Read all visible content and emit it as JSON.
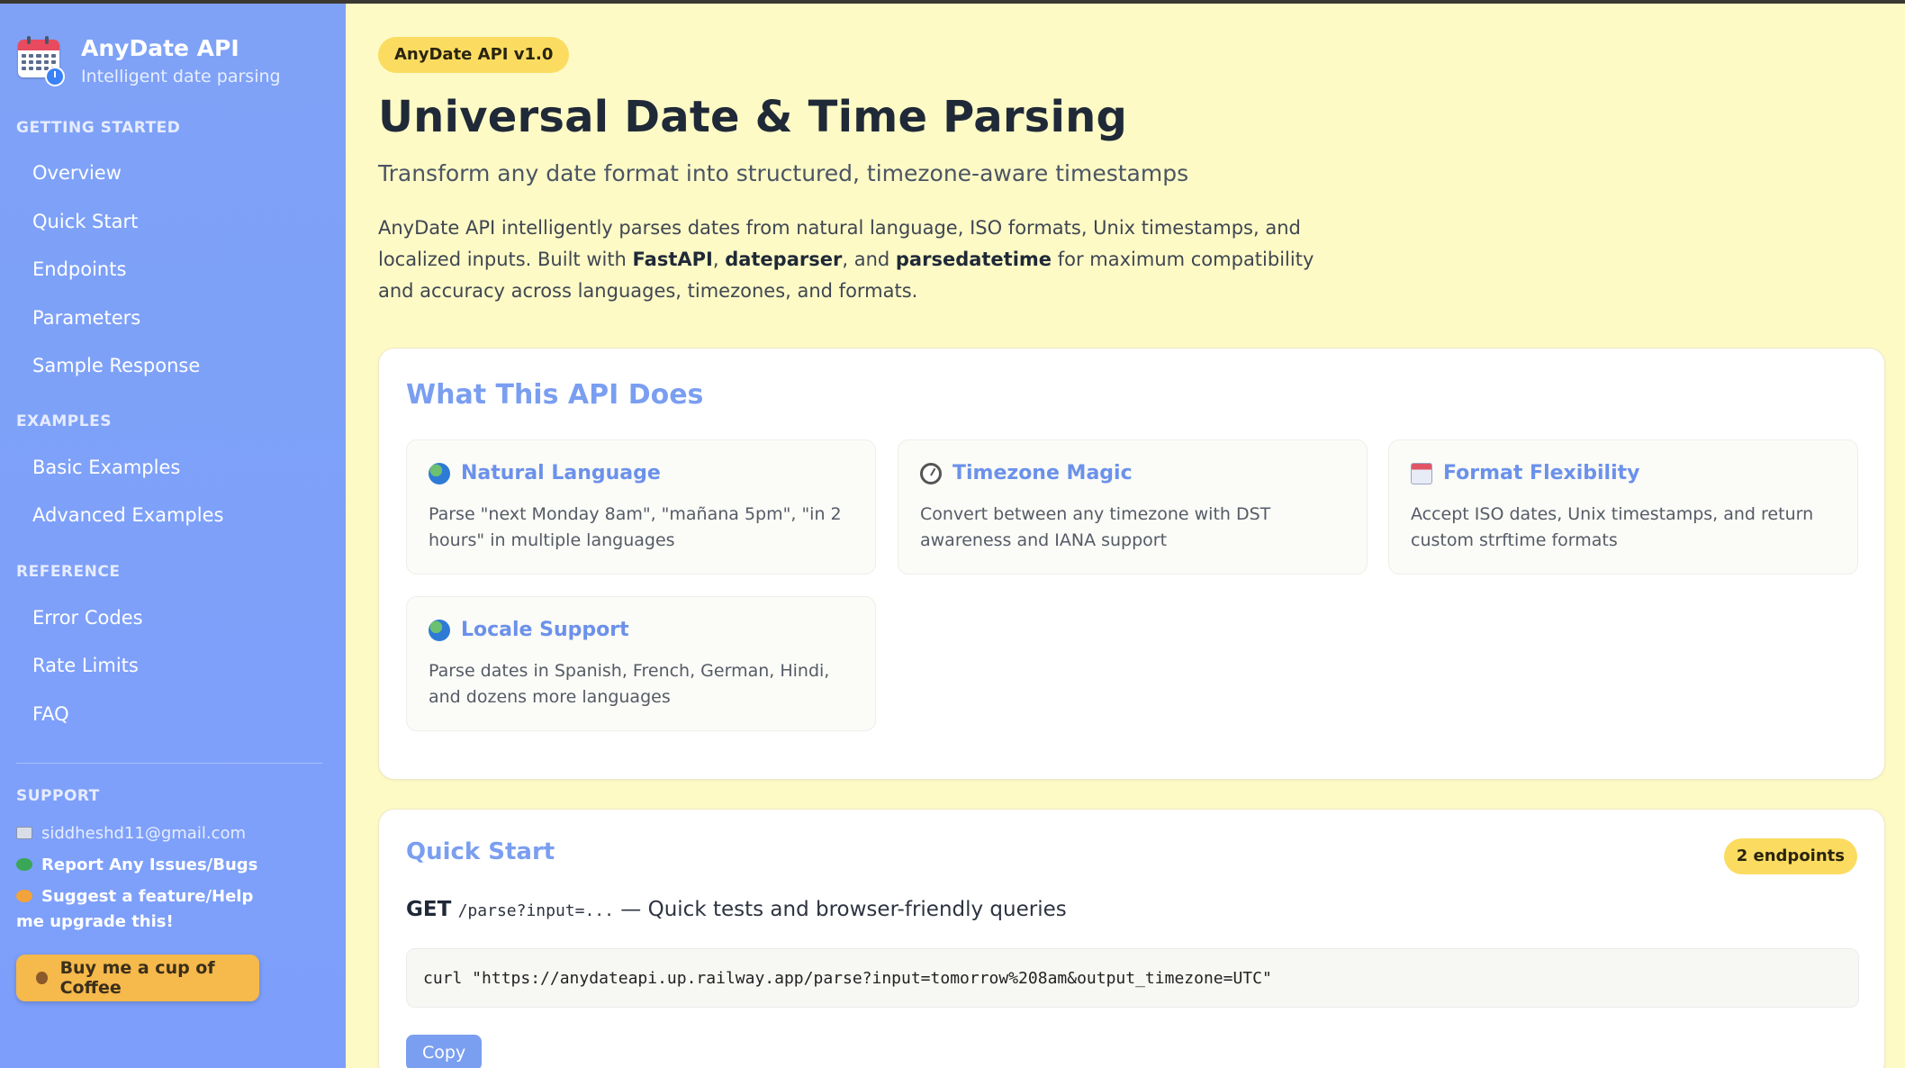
{
  "brand": {
    "title": "AnyDate API",
    "subtitle": "Intelligent date parsing"
  },
  "sidebar": {
    "sections": [
      {
        "label": "GETTING STARTED",
        "items": [
          "Overview",
          "Quick Start",
          "Endpoints",
          "Parameters",
          "Sample Response"
        ]
      },
      {
        "label": "EXAMPLES",
        "items": [
          "Basic Examples",
          "Advanced Examples"
        ]
      },
      {
        "label": "REFERENCE",
        "items": [
          "Error Codes",
          "Rate Limits",
          "FAQ"
        ]
      }
    ],
    "support": {
      "label": "SUPPORT",
      "email": "siddheshd11@gmail.com",
      "report": "Report Any Issues/Bugs",
      "suggest": "Suggest a feature/Help me upgrade this!",
      "coffee": "Buy me a cup of Coffee"
    }
  },
  "header": {
    "badge": "AnyDate API v1.0",
    "title": "Universal Date & Time Parsing",
    "subtitle": "Transform any date format into structured, timezone-aware timestamps",
    "intro_1": "AnyDate API intelligently parses dates from natural language, ISO formats, Unix timestamps, and localized inputs. Built with ",
    "lib_1": "FastAPI",
    "sep_1": ", ",
    "lib_2": "dateparser",
    "sep_2": ", and ",
    "lib_3": "parsedatetime",
    "intro_2": " for maximum compatibility and accuracy across languages, timezones, and formats."
  },
  "features_card": {
    "title": "What This API Does",
    "features": [
      {
        "icon": "globe-icon",
        "title": "Natural Language",
        "desc": "Parse \"next Monday 8am\", \"mañana 5pm\", \"in 2 hours\" in multiple languages"
      },
      {
        "icon": "clock-icon",
        "title": "Timezone Magic",
        "desc": "Convert between any timezone with DST awareness and IANA support"
      },
      {
        "icon": "calendar-icon",
        "title": "Format Flexibility",
        "desc": "Accept ISO dates, Unix timestamps, and return custom strftime formats"
      },
      {
        "icon": "globe-icon",
        "title": "Locale Support",
        "desc": "Parse dates in Spanish, French, German, Hindi, and dozens more languages"
      }
    ]
  },
  "quickstart": {
    "title": "Quick Start",
    "pill": "2 endpoints",
    "method": "GET",
    "path": "/parse?input=...",
    "desc": " — Quick tests and browser-friendly queries",
    "code": "curl \"https://anydateapi.up.railway.app/parse?input=tomorrow%208am&output_timezone=UTC\"",
    "copy_label": "Copy"
  },
  "colors": {
    "sidebar": "#7d9ffb",
    "accent": "#7a9ef0",
    "badge": "#fbdc60",
    "background": "#fdfac6"
  }
}
